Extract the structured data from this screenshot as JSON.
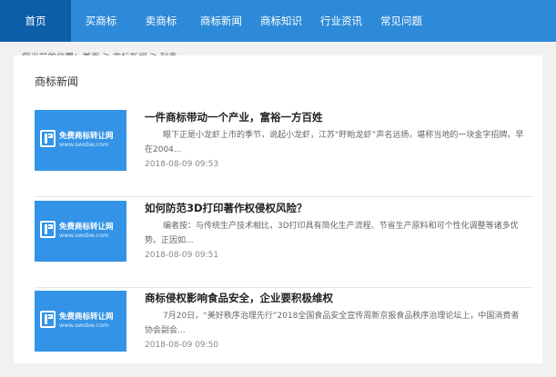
{
  "nav": {
    "items": [
      {
        "label": "首页"
      },
      {
        "label": "买商标"
      },
      {
        "label": "卖商标"
      },
      {
        "label": "商标新闻"
      },
      {
        "label": "商标知识"
      },
      {
        "label": "行业资讯"
      },
      {
        "label": "常见问题"
      }
    ],
    "active_index": 0
  },
  "breadcrumb": {
    "prefix": "您当前的位置：",
    "items": [
      "首页",
      "商标新闻",
      "列表"
    ],
    "separator": ">"
  },
  "panel": {
    "title": "商标新闻"
  },
  "thumbnail": {
    "brand": "免费商标转让网",
    "site": "www.swsbw.com",
    "color": "#3393e6",
    "icon": "logo-r-icon"
  },
  "articles": [
    {
      "title": "一件商标带动一个产业，富裕一方百姓",
      "summary": "眼下正是小龙虾上市的季节，说起小龙虾，江苏“盱眙龙虾”声名远扬，堪称当地的一块金字招牌。早在2004...",
      "date": "2018-08-09 09:53"
    },
    {
      "title": "如何防范3D打印著作权侵权风险？",
      "summary": "编者按：与传统生产技术相比，3D打印具有简化生产流程、节省生产原料和可个性化调整等诸多优势。正因如...",
      "date": "2018-08-09 09:51"
    },
    {
      "title": "商标侵权影响食品安全，企业要积极维权",
      "summary": "7月20日，“美好秩序治理先行”2018全国食品安全宣传周新京报食品秩序治理论坛上，中国消费者协会副会...",
      "date": "2018-08-09 09:50"
    }
  ],
  "colors": {
    "nav_bg": "#2d8ad8",
    "nav_active": "#0d5ea9",
    "page_bg": "#f1f1f1"
  }
}
